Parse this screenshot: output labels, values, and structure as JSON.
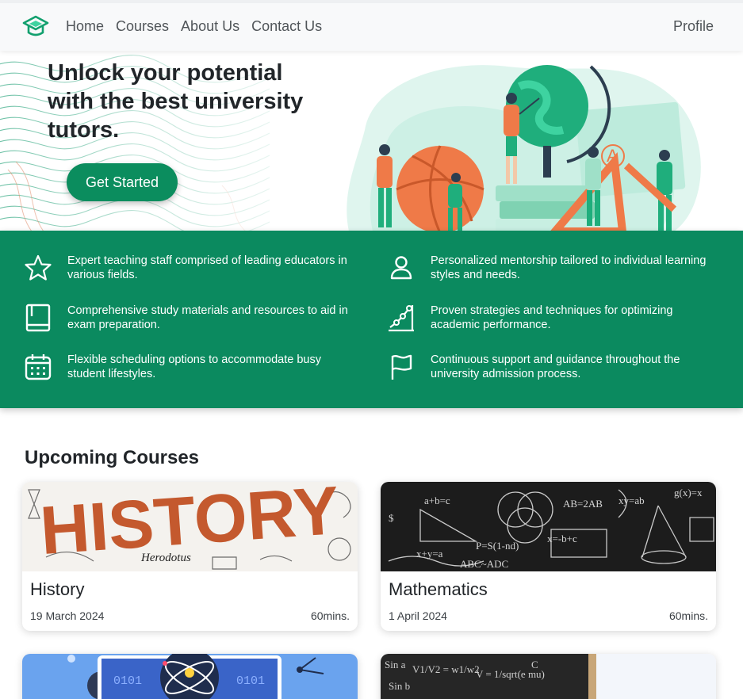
{
  "nav": {
    "links": [
      "Home",
      "Courses",
      "About Us",
      "Contact Us"
    ],
    "profile": "Profile",
    "logo_icon": "graduation-cap-icon"
  },
  "hero": {
    "title": "Unlock your potential with the best university tutors.",
    "cta": "Get Started"
  },
  "features": [
    {
      "icon": "star-icon",
      "text": "Expert teaching staff comprised of leading educators in various fields."
    },
    {
      "icon": "user-icon",
      "text": "Personalized mentorship tailored to individual learning styles and needs."
    },
    {
      "icon": "book-icon",
      "text": "Comprehensive study materials and resources to aid in exam preparation."
    },
    {
      "icon": "chart-steps-icon",
      "text": "Proven strategies and techniques for optimizing academic performance."
    },
    {
      "icon": "calendar-icon",
      "text": "Flexible scheduling options to accommodate busy student lifestyles."
    },
    {
      "icon": "flag-icon",
      "text": "Continuous support and guidance throughout the university admission process."
    }
  ],
  "courses": {
    "title": "Upcoming Courses",
    "items": [
      {
        "name": "History",
        "date": "19 March 2024",
        "duration": "60mins.",
        "image_text": "HISTORY",
        "image_caption": "Herodotus"
      },
      {
        "name": "Mathematics",
        "date": "1 April 2024",
        "duration": "60mins."
      }
    ]
  },
  "colors": {
    "brand": "#0b8d5e",
    "features_bg": "#0b8a5f",
    "history_orange": "#c4592e",
    "chalkboard": "#1c1c1c"
  }
}
